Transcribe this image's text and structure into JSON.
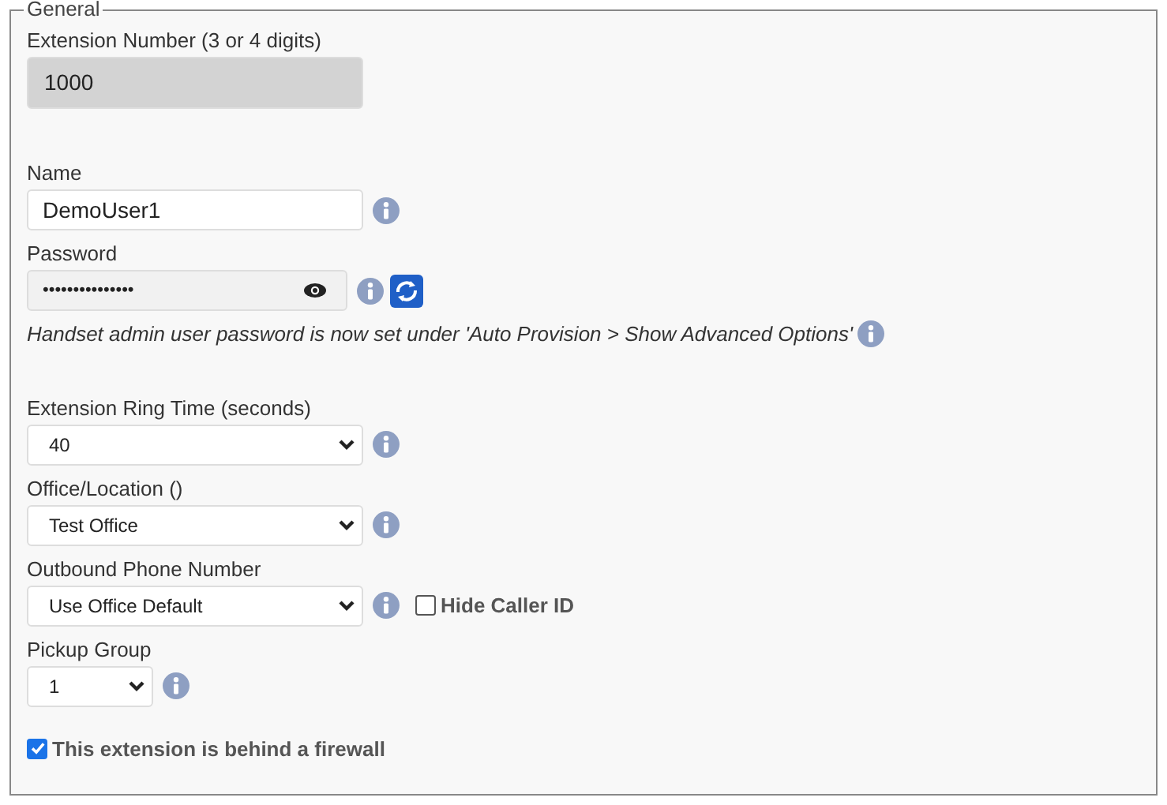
{
  "section": {
    "legend": "General"
  },
  "fields": [
    {
      "kind": "readonly",
      "label": "Extension Number (3 or 4 digits)",
      "value": "1000",
      "info": false
    },
    {
      "kind": "text",
      "label": "Name",
      "value": "DemoUser1",
      "info": true
    },
    {
      "kind": "password",
      "label": "Password",
      "value": "•••••••••••••••",
      "info": true,
      "note": "Handset admin user password is now set under 'Auto Provision > Show Advanced Options'"
    },
    {
      "kind": "select",
      "label": "Extension Ring Time (seconds)",
      "value": "40",
      "info": true
    },
    {
      "kind": "select",
      "label": "Office/Location ()",
      "value": "Test Office",
      "info": true
    },
    {
      "kind": "select",
      "label": "Outbound Phone Number",
      "value": "Use Office Default",
      "info": true,
      "checkbox": {
        "label": "Hide Caller ID",
        "checked": false
      }
    },
    {
      "kind": "small-select",
      "label": "Pickup Group",
      "value": "1",
      "info": true
    }
  ],
  "firewall": {
    "label": "This extension is behind a firewall",
    "checked": true
  }
}
